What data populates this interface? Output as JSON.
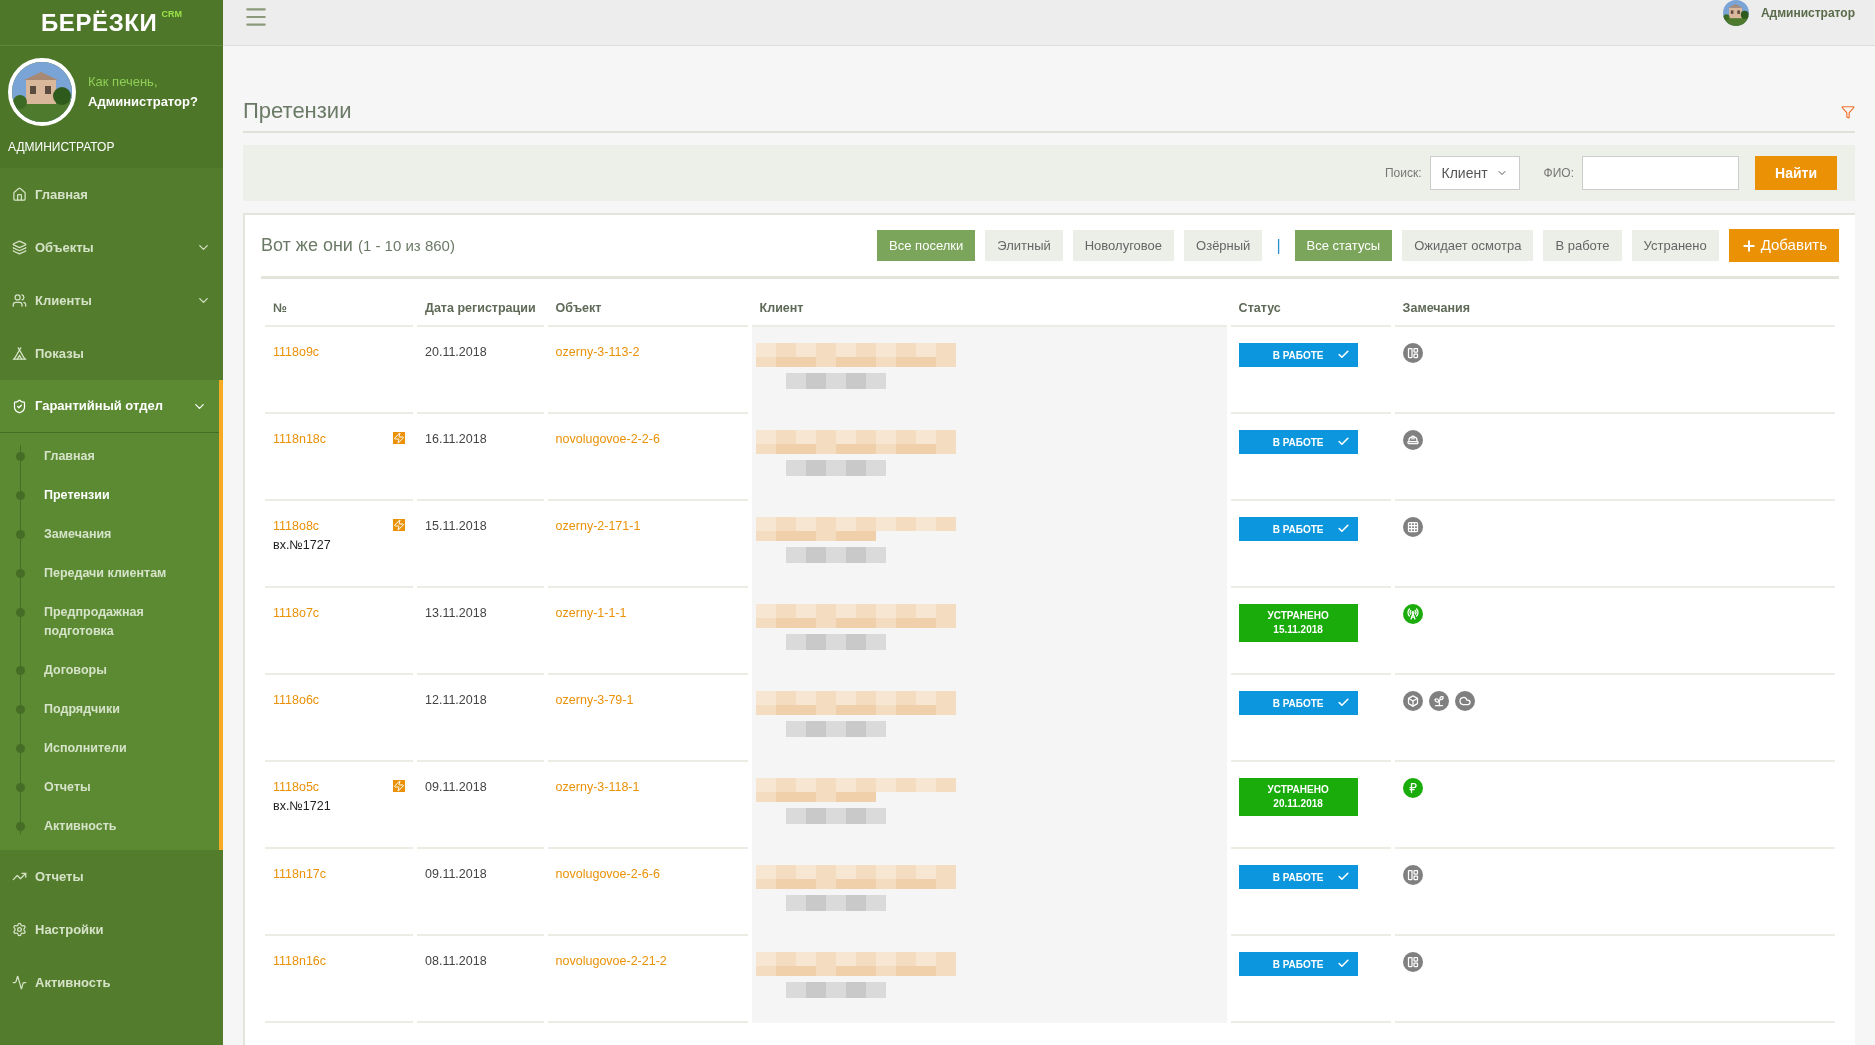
{
  "logo": {
    "text": "БЕРЁЗКИ",
    "badge": "CRM"
  },
  "profile": {
    "greeting": "Как печень,",
    "name": "Администратор?",
    "role": "АДМИНИСТРАТОР"
  },
  "sidebar": {
    "items": [
      {
        "label": "Главная",
        "kind": "home",
        "expandable": false,
        "selected": false
      },
      {
        "label": "Объекты",
        "kind": "layers",
        "expandable": true,
        "selected": false
      },
      {
        "label": "Клиенты",
        "kind": "users",
        "expandable": true,
        "selected": false
      },
      {
        "label": "Показы",
        "kind": "tent",
        "expandable": false,
        "selected": false
      },
      {
        "label": "Гарантийный отдел",
        "kind": "shield",
        "expandable": true,
        "selected": true,
        "children": [
          {
            "label": "Главная",
            "selected": false
          },
          {
            "label": "Претензии",
            "selected": true
          },
          {
            "label": "Замечания",
            "selected": false
          },
          {
            "label": "Передачи клиентам",
            "selected": false
          },
          {
            "label": "Предпродажная подготовка",
            "selected": false
          },
          {
            "label": "Договоры",
            "selected": false
          },
          {
            "label": "Подрядчики",
            "selected": false
          },
          {
            "label": "Исполнители",
            "selected": false
          },
          {
            "label": "Отчеты",
            "selected": false
          },
          {
            "label": "Активность",
            "selected": false
          }
        ]
      },
      {
        "label": "Отчеты",
        "kind": "chart",
        "expandable": false,
        "selected": false
      },
      {
        "label": "Настройки",
        "kind": "gear",
        "expandable": false,
        "selected": false
      },
      {
        "label": "Активность",
        "kind": "pulse",
        "expandable": false,
        "selected": false
      }
    ]
  },
  "header": {
    "user": "Администратор"
  },
  "page_title": "Претензии",
  "search": {
    "label": "Поиск:",
    "type": "Клиент",
    "name_label": "ФИО:",
    "button": "Найти"
  },
  "list": {
    "title": "Вот же они",
    "count": "(1 - 10 из 860)",
    "village_filters": [
      {
        "label": "Все поселки",
        "selected": true
      },
      {
        "label": "Элитный",
        "selected": false
      },
      {
        "label": "Новолуговое",
        "selected": false
      },
      {
        "label": "Озёрный",
        "selected": false
      }
    ],
    "separator": "|",
    "status_filters": [
      {
        "label": "Все статусы",
        "selected": true
      },
      {
        "label": "Ожидает осмотра",
        "selected": false
      },
      {
        "label": "В работе",
        "selected": false
      },
      {
        "label": "Устранено",
        "selected": false
      }
    ],
    "add_button": "Добавить"
  },
  "table": {
    "columns": [
      "№",
      "Дата регистрации",
      "Объект",
      "Клиент",
      "Статус",
      "Замечания"
    ],
    "rows": [
      {
        "id": "1118o9c",
        "attachment": false,
        "date": "20.11.2018",
        "object": "ozerny-3-113-2",
        "status": {
          "kind": "in_progress",
          "label": "В РАБОТЕ"
        },
        "remarks": [
          {
            "kind": "grid",
            "color": "#808080"
          }
        ]
      },
      {
        "id": "1118n18c",
        "attachment": true,
        "date": "16.11.2018",
        "object": "novolugovoe-2-2-6",
        "status": {
          "kind": "in_progress",
          "label": "В РАБОТЕ"
        },
        "remarks": [
          {
            "kind": "helmet",
            "color": "#808080"
          }
        ]
      },
      {
        "id": "1118o8c",
        "note": "вх.№1727",
        "attachment": true,
        "date": "15.11.2018",
        "object": "ozerny-2-171-1",
        "status": {
          "kind": "in_progress",
          "label": "В РАБОТЕ"
        },
        "remarks": [
          {
            "kind": "pattern",
            "color": "#808080"
          }
        ]
      },
      {
        "id": "1118o7c",
        "attachment": false,
        "date": "13.11.2018",
        "object": "ozerny-1-1-1",
        "status": {
          "kind": "fixed",
          "label": "УСТРАНЕНО",
          "date": "15.11.2018"
        },
        "remarks": [
          {
            "kind": "tower",
            "color": "#1aac0a"
          }
        ]
      },
      {
        "id": "1118o6c",
        "attachment": false,
        "date": "12.11.2018",
        "object": "ozerny-3-79-1",
        "status": {
          "kind": "in_progress",
          "label": "В РАБОТЕ"
        },
        "remarks": [
          {
            "kind": "box",
            "color": "#808080"
          },
          {
            "kind": "plant",
            "color": "#808080"
          },
          {
            "kind": "cloud",
            "color": "#808080"
          }
        ]
      },
      {
        "id": "1118o5c",
        "note": "вх.№1721",
        "attachment": true,
        "date": "09.11.2018",
        "object": "ozerny-3-118-1",
        "status": {
          "kind": "fixed",
          "label": "УСТРАНЕНО",
          "date": "20.11.2018"
        },
        "remarks": [
          {
            "kind": "ruble",
            "color": "#1aac0a"
          }
        ]
      },
      {
        "id": "1118n17c",
        "attachment": false,
        "date": "09.11.2018",
        "object": "novolugovoe-2-6-6",
        "status": {
          "kind": "in_progress",
          "label": "В РАБОТЕ"
        },
        "remarks": [
          {
            "kind": "grid",
            "color": "#808080"
          }
        ]
      },
      {
        "id": "1118n16c",
        "attachment": false,
        "date": "08.11.2018",
        "object": "novolugovoe-2-21-2",
        "status": {
          "kind": "in_progress",
          "label": "В РАБОТЕ"
        },
        "remarks": [
          {
            "kind": "grid",
            "color": "#808080"
          }
        ]
      }
    ]
  }
}
